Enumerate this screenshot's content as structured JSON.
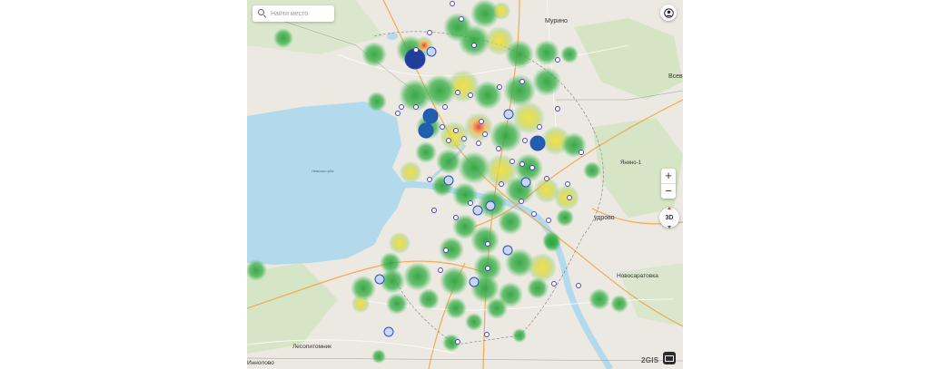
{
  "search": {
    "placeholder": "Найти место"
  },
  "labels": {
    "murino": "Мурино",
    "vsev": "Всев",
    "yanino": "Янино-1",
    "kudrovo": "удрово",
    "novosaratovka": "Новосаратовка",
    "lesoplitomnik": "Лесопитомник",
    "innolovo": "Иннолово",
    "nevskaya_guba": "Невская губа"
  },
  "controls": {
    "zoom_in": "+",
    "zoom_out": "−",
    "btn_3d": "3D",
    "brand": "2GIS"
  },
  "icons": [
    "search-icon",
    "user-icon",
    "chat-icon"
  ],
  "colors": {
    "water": "#b3d9ec",
    "forest": "#c8dfb4",
    "heat": "#2e9e3e",
    "marker": "#ffffff",
    "marker_border": "#4a3fc7",
    "cluster": "#1e5fb0"
  }
}
